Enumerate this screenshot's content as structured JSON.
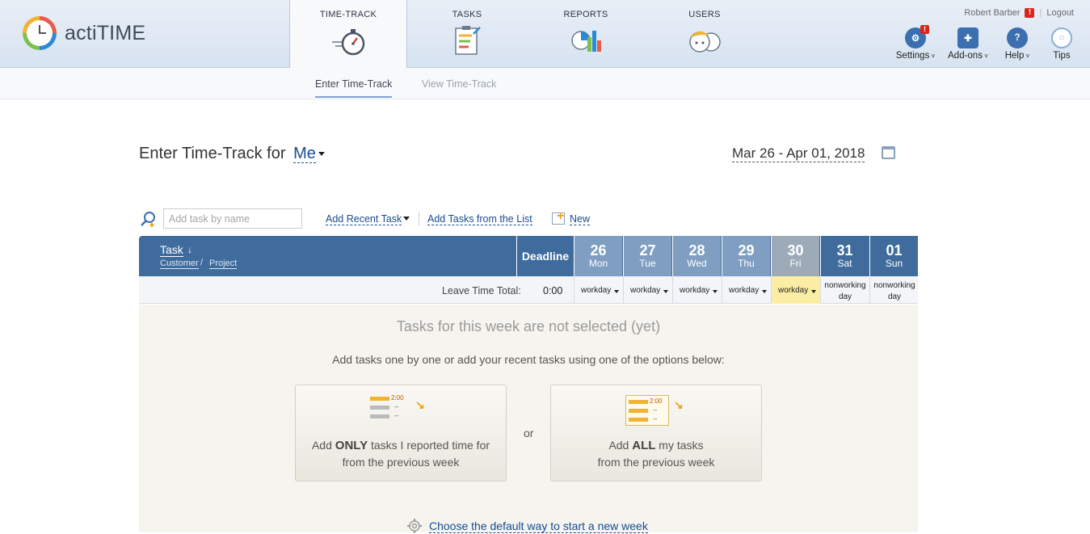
{
  "app": {
    "name": "actiTIME"
  },
  "nav": {
    "tabs": [
      {
        "label": "TIME-TRACK",
        "active": true
      },
      {
        "label": "TASKS",
        "active": false
      },
      {
        "label": "REPORTS",
        "active": false
      },
      {
        "label": "USERS",
        "active": false
      }
    ]
  },
  "user": {
    "name": "Robert Barber",
    "alert": "!",
    "logout": "Logout"
  },
  "tools": [
    {
      "label": "Settings",
      "icon": "gear-icon",
      "has_menu": true,
      "badge": "!"
    },
    {
      "label": "Add-ons",
      "icon": "puzzle-icon",
      "has_menu": true
    },
    {
      "label": "Help",
      "icon": "help-icon",
      "has_menu": true
    },
    {
      "label": "Tips",
      "icon": "lightbulb-icon",
      "has_menu": false
    }
  ],
  "subnav": {
    "enter": "Enter Time-Track",
    "view": "View Time-Track"
  },
  "page": {
    "title": "Enter Time-Track for",
    "user_select": "Me",
    "date_range": "Mar 26 - Apr 01, 2018"
  },
  "toolbar": {
    "search_placeholder": "Add task by name",
    "add_recent": "Add Recent Task",
    "add_from_list": "Add Tasks from the List",
    "new": "New"
  },
  "table": {
    "task_header": "Task",
    "sort_arrow": "↓",
    "customer_header": "Customer",
    "slash": "/",
    "project_header": "Project",
    "deadline_header": "Deadline",
    "days": [
      {
        "num": "26",
        "name": "Mon",
        "status": "workday",
        "color": "#7f9ec1"
      },
      {
        "num": "27",
        "name": "Tue",
        "status": "workday",
        "color": "#7f9ec1"
      },
      {
        "num": "28",
        "name": "Wed",
        "status": "workday",
        "color": "#7f9ec1"
      },
      {
        "num": "29",
        "name": "Thu",
        "status": "workday",
        "color": "#7f9ec1"
      },
      {
        "num": "30",
        "name": "Fri",
        "status": "workday",
        "color": "#9dabb8",
        "highlight": true
      },
      {
        "num": "31",
        "name": "Sat",
        "status": "nonworking day",
        "color": "#3f6c9d"
      },
      {
        "num": "01",
        "name": "Sun",
        "status": "nonworking day",
        "color": "#3f6c9d"
      }
    ],
    "leave_label": "Leave Time Total:",
    "leave_total": "0:00"
  },
  "empty_state": {
    "title": "Tasks for this week are not selected (yet)",
    "subtitle": "Add tasks one by one or add your recent tasks using one of the options below:",
    "option1_pre": "Add ",
    "option1_bold": "ONLY",
    "option1_post": " tasks I reported time for",
    "option1_line2": "from the previous week",
    "or": "or",
    "option2_pre": "Add ",
    "option2_bold": "ALL",
    "option2_post": " my tasks",
    "option2_line2": "from the previous week",
    "mini_time": "2:00",
    "mini_dash": "--",
    "choose_link": "Choose the default way to start a new week"
  }
}
